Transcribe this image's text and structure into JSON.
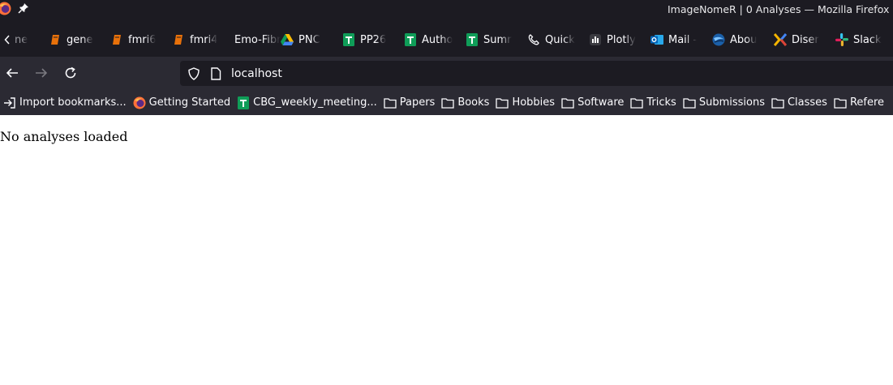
{
  "window": {
    "title": "ImageNomeR | 0 Analyses — Mozilla Firefox"
  },
  "tabs": [
    {
      "label": "ne",
      "icon": "blank-icon"
    },
    {
      "label": "gene",
      "icon": "book-icon"
    },
    {
      "label": "fmri6",
      "icon": "book-icon"
    },
    {
      "label": "fmri4",
      "icon": "book-icon"
    },
    {
      "label": "Emo-Fibr",
      "icon": "none"
    },
    {
      "label": "PNC",
      "icon": "google-drive-icon"
    },
    {
      "label": "PP26",
      "icon": "google-sheets-icon"
    },
    {
      "label": "Autho",
      "icon": "google-sheets-icon"
    },
    {
      "label": "Sumr",
      "icon": "google-sheets-icon"
    },
    {
      "label": "Quick",
      "icon": "phone-icon"
    },
    {
      "label": "Plotly",
      "icon": "plotly-icon"
    },
    {
      "label": "Mail -",
      "icon": "outlook-icon"
    },
    {
      "label": "Abou",
      "icon": "globe-icon"
    },
    {
      "label": "Diser",
      "icon": "x-logo-icon"
    },
    {
      "label": "Slack",
      "icon": "slack-icon"
    }
  ],
  "navbar": {
    "url": "localhost"
  },
  "bookmarks": [
    {
      "label": "Import bookmarks...",
      "icon": "import-icon"
    },
    {
      "label": "Getting Started",
      "icon": "firefox-icon"
    },
    {
      "label": "CBG_weekly_meeting...",
      "icon": "google-sheets-icon"
    },
    {
      "label": "Papers",
      "icon": "folder-icon"
    },
    {
      "label": "Books",
      "icon": "folder-icon"
    },
    {
      "label": "Hobbies",
      "icon": "folder-icon"
    },
    {
      "label": "Software",
      "icon": "folder-icon"
    },
    {
      "label": "Tricks",
      "icon": "folder-icon"
    },
    {
      "label": "Submissions",
      "icon": "folder-icon"
    },
    {
      "label": "Classes",
      "icon": "folder-icon"
    },
    {
      "label": "Refere",
      "icon": "folder-icon"
    }
  ],
  "content": {
    "message": "No analyses loaded"
  },
  "colors": {
    "titlebar_bg": "#1c1b22",
    "toolbar_bg": "#2b2a33",
    "urlbar_bg": "#1c1b22",
    "sheets_green": "#0f9d58",
    "book_orange": "#e8710a"
  }
}
